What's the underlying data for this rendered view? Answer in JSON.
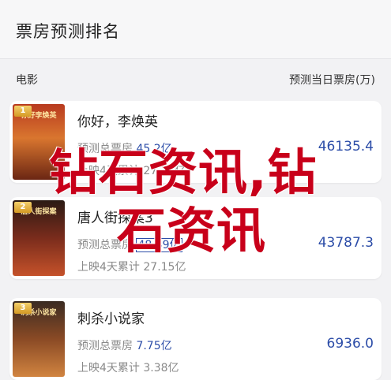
{
  "header": {
    "title": "票房预测排名"
  },
  "columns": {
    "movie": "电影",
    "box_office": "预测当日票房(万)"
  },
  "movies": [
    {
      "rank": "1",
      "name": "你好，李焕英",
      "poster_text": "你好李焕英",
      "forecast_label": "预测总票房",
      "forecast_value": "45.2亿",
      "cumulative_label": "上映4天累计",
      "cumulative_value": "27.15亿",
      "box_office": "46135.4"
    },
    {
      "rank": "2",
      "name": "唐人街探案3",
      "poster_text": "唐人街探案",
      "forecast_label": "预测总票房",
      "forecast_value": "48.49亿",
      "cumulative_label": "上映4天累计",
      "cumulative_value": "27.15亿",
      "box_office": "43787.3"
    },
    {
      "rank": "3",
      "name": "刺杀小说家",
      "poster_text": "刺杀小说家",
      "forecast_label": "预测总票房",
      "forecast_value": "7.75亿",
      "cumulative_label": "上映4天累计",
      "cumulative_value": "3.38亿",
      "box_office": "6936.0"
    }
  ],
  "watermark": {
    "line1": "钻石资讯,钻",
    "line2": "石资讯"
  },
  "colors": {
    "accent": "#2c4da8",
    "watermark": "#c8001a",
    "badge": "#e2ad3a"
  }
}
